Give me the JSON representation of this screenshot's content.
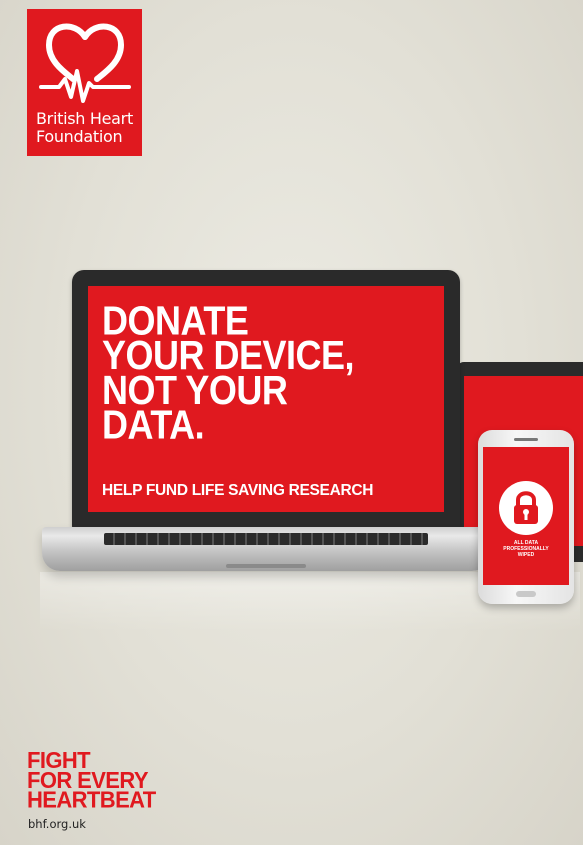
{
  "brand": {
    "logo_lines": [
      "British Heart",
      "Foundation"
    ],
    "logo_color": "#e0191f"
  },
  "laptop": {
    "headline_lines": [
      "DONATE",
      "YOUR DEVICE,",
      "NOT YOUR",
      "DATA."
    ],
    "subline": "HELP FUND LIFE SAVING RESEARCH",
    "screen_color": "#e0191f"
  },
  "phone": {
    "lock_icon": "padlock-icon",
    "message_lines": [
      "ALL DATA",
      "PROFESSIONALLY",
      "WIPED"
    ]
  },
  "footer": {
    "tagline_lines": [
      "FIGHT",
      "FOR EVERY",
      "HEARTBEAT"
    ],
    "website": "bhf.org.uk",
    "tagline_color": "#e0191f"
  }
}
